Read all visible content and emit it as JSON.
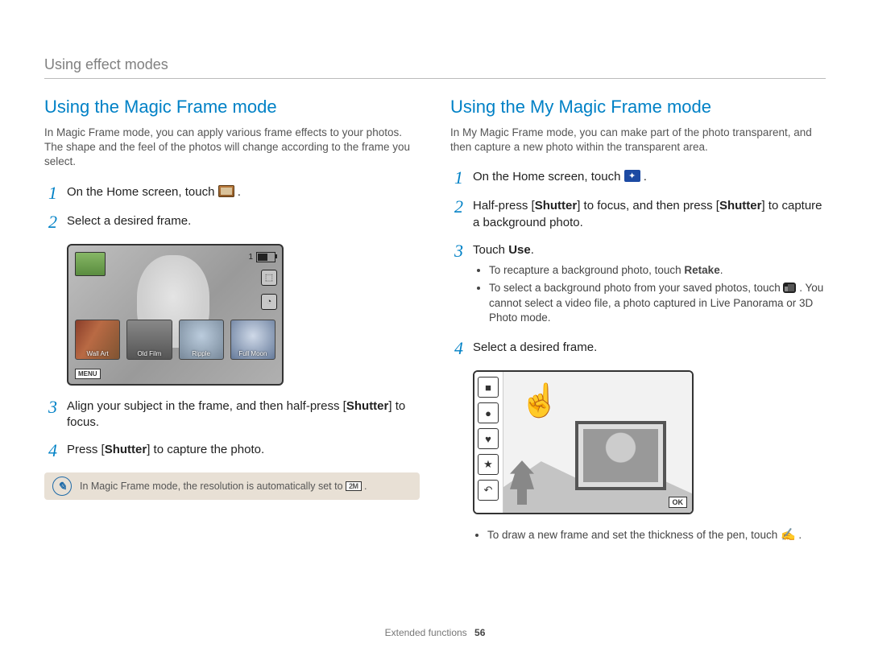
{
  "section_title": "Using effect modes",
  "footer": {
    "label": "Extended functions",
    "page": "56"
  },
  "left": {
    "title": "Using the Magic Frame mode",
    "intro": "In Magic Frame mode, you can apply various frame effects to your photos. The shape and the feel of the photos will change according to the frame you select.",
    "steps": {
      "s1a": "On the Home screen, touch ",
      "s1b": ".",
      "s2": "Select a desired frame.",
      "s3a": "Align your subject in the frame, and then half-press [",
      "s3b": "Shutter",
      "s3c": "] to focus.",
      "s4a": "Press [",
      "s4b": "Shutter",
      "s4c": "] to capture the photo."
    },
    "note_a": "In Magic Frame mode, the resolution is automatically set to ",
    "note_b": ".",
    "note_badge": "2M",
    "screenshot": {
      "count": "1",
      "frames": [
        "Wall Art",
        "Old Film",
        "Ripple",
        "Full Moon"
      ],
      "menu": "MENU"
    }
  },
  "right": {
    "title": "Using the My Magic Frame mode",
    "intro": "In My Magic Frame mode, you can make part of the photo transparent, and then capture a new photo within the transparent area.",
    "steps": {
      "s1a": "On the Home screen, touch ",
      "s1b": ".",
      "s2a": "Half-press [",
      "s2b": "Shutter",
      "s2c": "] to focus, and then press [",
      "s2d": "Shutter",
      "s2e": "] to capture a background photo.",
      "s3a": "Touch ",
      "s3b": "Use",
      "s3c": ".",
      "s3_bullets": {
        "b1a": "To recapture a background photo, touch ",
        "b1b": "Retake",
        "b1c": ".",
        "b2a": "To select a background photo from your saved photos, touch ",
        "b2b": ". You cannot select a video file, a photo captured in Live Panorama or 3D Photo mode."
      },
      "s4": "Select a desired frame."
    },
    "trail_a": "To draw a new frame and set the thickness of the pen, touch ",
    "trail_b": ".",
    "screenshot": {
      "ok": "OK"
    }
  }
}
